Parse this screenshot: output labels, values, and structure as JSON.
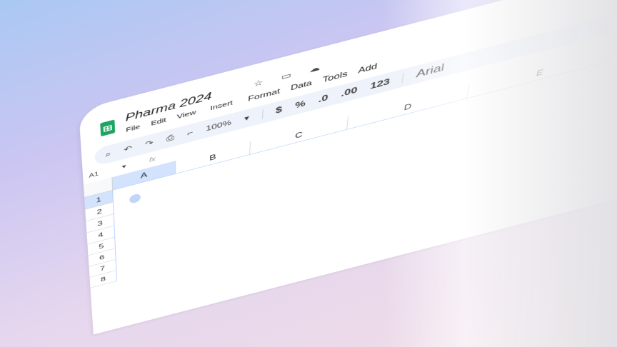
{
  "app": {
    "doc_title": "Pharma 2024",
    "brand_color": "#1fa463",
    "accent_color": "#d3e3fd"
  },
  "menu": [
    "File",
    "Edit",
    "View",
    "Insert",
    "Format",
    "Data",
    "Tools",
    "Add"
  ],
  "top_icons": [
    "star-icon",
    "folder-icon",
    "cloud-icon"
  ],
  "toolbar": {
    "zoom": "100%",
    "currency": "$",
    "percent": "%",
    "dec_decrease": ".0",
    "dec_increase": ".00",
    "number_format": "123",
    "font": "Arial"
  },
  "formula_bar": {
    "cell_ref": "A1",
    "fx": "fx"
  },
  "columns": [
    "A",
    "B",
    "C",
    "D",
    "E"
  ],
  "rows": [
    "1",
    "2",
    "3",
    "4",
    "5",
    "6",
    "7",
    "8"
  ]
}
